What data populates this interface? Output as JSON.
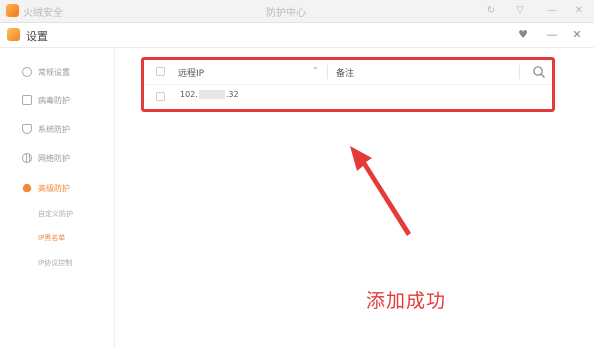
{
  "background_window": {
    "app_name": "火绒安全",
    "center_title": "防护中心",
    "controls": [
      "↻",
      "▽",
      "—",
      "✕"
    ]
  },
  "dialog": {
    "title": "设置",
    "controls": [
      "♥",
      "—",
      "✕"
    ]
  },
  "sidebar": {
    "items": [
      {
        "label": "常规设置",
        "icon": "gear-icon"
      },
      {
        "label": "病毒防护",
        "icon": "virus-shield-icon"
      },
      {
        "label": "系统防护",
        "icon": "system-shield-icon"
      },
      {
        "label": "网络防护",
        "icon": "globe-icon"
      },
      {
        "label": "高级防护",
        "icon": "flame-icon",
        "active": true
      }
    ],
    "sub_items": [
      {
        "label": "自定义防护"
      },
      {
        "label": "IP黑名单",
        "active": true
      },
      {
        "label": "IP协议控制"
      }
    ]
  },
  "table": {
    "headers": {
      "remote_ip": "远程IP",
      "note": "备注"
    },
    "rows": [
      {
        "ip_prefix": "102.",
        "ip_suffix": ".32",
        "note": ""
      }
    ]
  },
  "annotation": {
    "caption": "添加成功",
    "color": "#e53a3a"
  },
  "colors": {
    "accent": "#f2873a",
    "highlight": "#e53a3a"
  }
}
